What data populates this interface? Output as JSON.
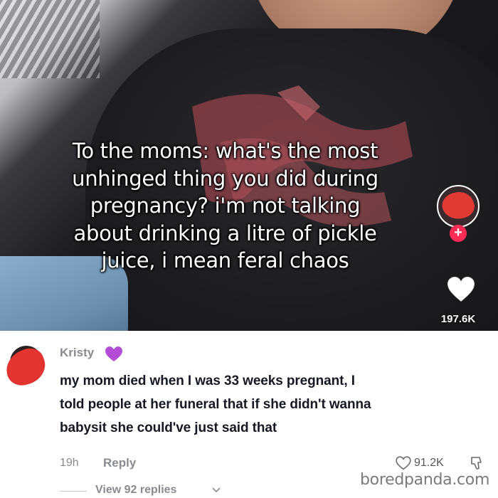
{
  "video": {
    "caption_lines": [
      "To the moms: what's the most",
      "unhinged thing you did during",
      "pregnancy? i'm not talking",
      "about drinking a litre of pickle",
      "juice, i mean feral chaos"
    ],
    "like_count": "197.6K",
    "follow_symbol": "+",
    "like_icon": "heart-icon"
  },
  "comment": {
    "author": "Kristy",
    "author_badge_icon": "purple-heart-icon",
    "author_badge_color": "#b44dd6",
    "lines": [
      "my mom died when I was 33 weeks pregnant, I",
      "told people at her funeral that if she didn't wanna",
      "babysit she could've just said that"
    ],
    "time": "19h",
    "reply_label": "Reply",
    "like_count": "91.2K",
    "view_replies": "View 92 replies"
  },
  "watermark": "boredpanda.com",
  "colors": {
    "follow": "#fe2c55",
    "redaction": "#e3342f",
    "muted_text": "#8a8b91"
  }
}
